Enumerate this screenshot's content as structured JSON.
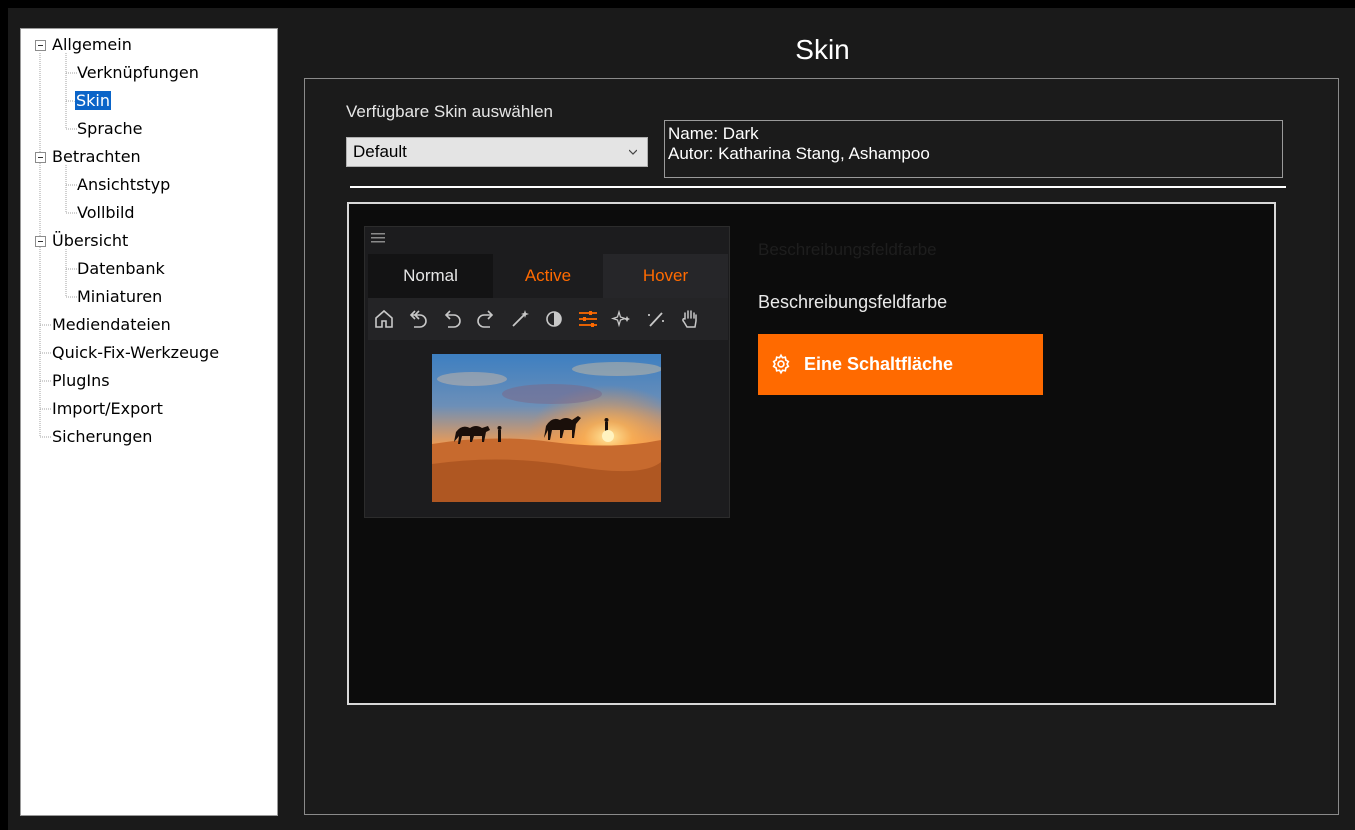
{
  "window": {
    "title": "Skin"
  },
  "sidebar": {
    "items": [
      {
        "label": "Allgemein"
      },
      {
        "label": "Verknüpfungen"
      },
      {
        "label": "Skin"
      },
      {
        "label": "Sprache"
      },
      {
        "label": "Betrachten"
      },
      {
        "label": "Ansichtstyp"
      },
      {
        "label": "Vollbild"
      },
      {
        "label": "Übersicht"
      },
      {
        "label": "Datenbank"
      },
      {
        "label": "Miniaturen"
      },
      {
        "label": "Mediendateien"
      },
      {
        "label": "Quick-Fix-Werkzeuge"
      },
      {
        "label": "PlugIns"
      },
      {
        "label": "Import/Export"
      },
      {
        "label": "Sicherungen"
      }
    ],
    "selected": "Skin"
  },
  "skin": {
    "select_label": "Verfügbare Skin auswählen",
    "selected_value": "Default",
    "info_name": "Name: Dark",
    "info_author": "Autor: Katharina Stang, Ashampoo"
  },
  "preview": {
    "tabs": [
      {
        "label": "Normal"
      },
      {
        "label": "Active"
      },
      {
        "label": "Hover"
      }
    ],
    "toolbar_icons": [
      "home-icon",
      "undo-all-icon",
      "undo-icon",
      "redo-icon",
      "magic-wand-icon",
      "contrast-icon",
      "sliders-icon",
      "sparkle-icon",
      "brush-icon",
      "hand-icon"
    ],
    "ghost_label": "Beschreibungsfeldfarbe",
    "field_label": "Beschreibungsfeldfarbe",
    "button_label": "Eine Schaltfläche",
    "accent_color": "#ff6a00"
  }
}
